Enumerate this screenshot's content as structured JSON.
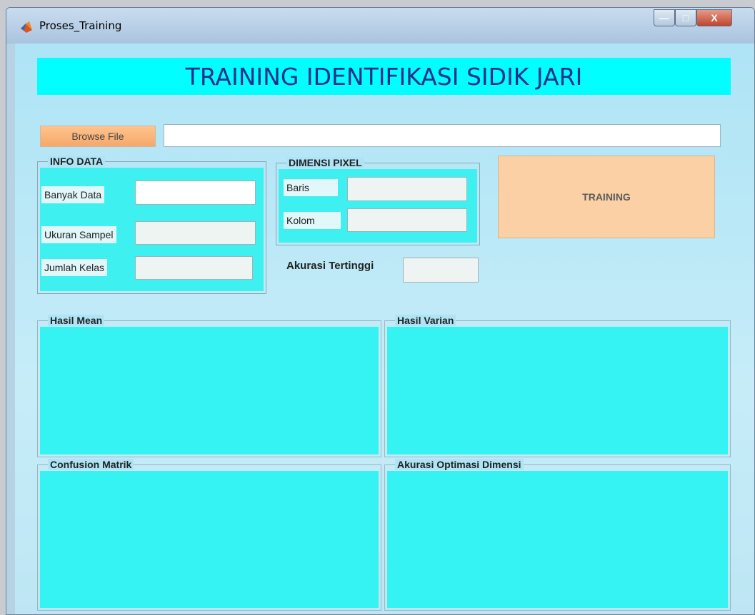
{
  "window": {
    "title": "Proses_Training",
    "controls": {
      "minimize": "—",
      "maximize": "□",
      "close": "X"
    }
  },
  "banner": {
    "title": "TRAINING IDENTIFIKASI SIDIK JARI"
  },
  "browse": {
    "button_label": "Browse File",
    "path_value": ""
  },
  "info_data": {
    "title": "INFO DATA",
    "banyak_data_label": "Banyak Data",
    "ukuran_sampel_label": "Ukuran Sampel",
    "jumlah_kelas_label": "Jumlah Kelas",
    "banyak_data_value": "",
    "ukuran_sampel_value": "",
    "jumlah_kelas_value": ""
  },
  "dimensi_pixel": {
    "title": "DIMENSI PIXEL",
    "baris_label": "Baris",
    "kolom_label": "Kolom",
    "baris_value": "",
    "kolom_value": ""
  },
  "training": {
    "button_label": "TRAINING"
  },
  "akurasi": {
    "label": "Akurasi Tertinggi",
    "value": ""
  },
  "plots": {
    "mean_title": "Hasil Mean",
    "varian_title": "Hasil Varian",
    "confusion_title": "Confusion Matrik",
    "optimasi_title": "Akurasi Optimasi Dimensi"
  },
  "colors": {
    "banner_bg": "#00ffff",
    "banner_text": "#1a2f8e",
    "panel_fill": "#3ff0f0",
    "button_orange": "#f5a86a",
    "training_button": "#fbd0a4"
  },
  "icons": {
    "app": "matlab-logo-icon"
  }
}
